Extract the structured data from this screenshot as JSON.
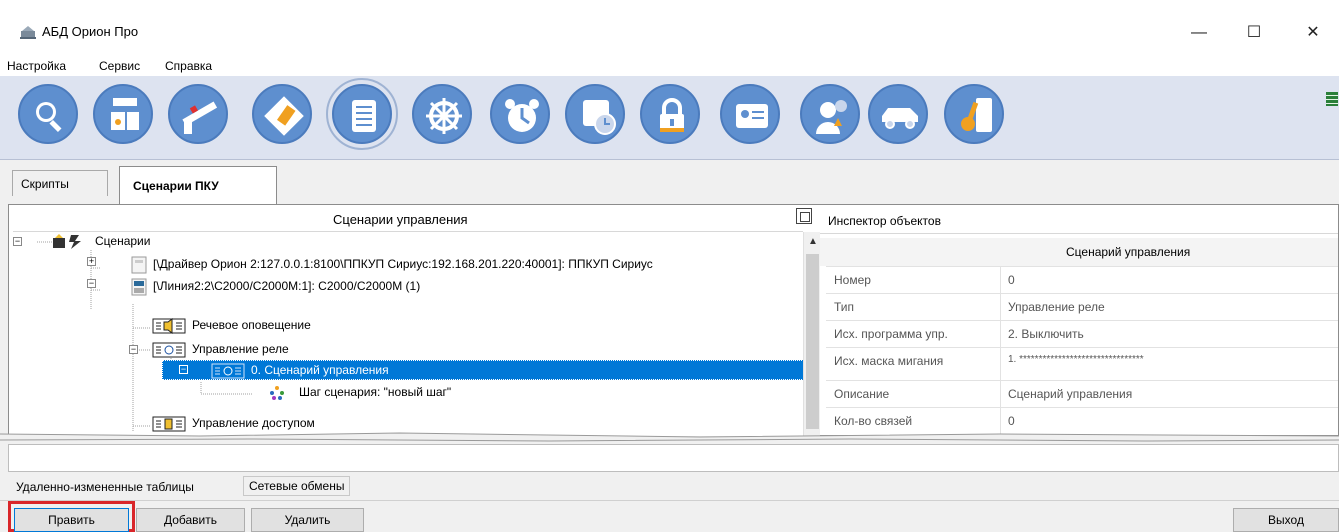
{
  "window": {
    "title": "АБД Орион Про",
    "minimize": "—",
    "maximize": "☐",
    "close": "✕"
  },
  "menu": [
    "Настройка",
    "Сервис",
    "Справка"
  ],
  "toolbar": {
    "buttons": [
      "search-icon",
      "devices-icon",
      "barrier-icon",
      "map-icon",
      "list-icon",
      "helm-icon",
      "alarm-clock-icon",
      "schedule-icon",
      "lock-icon",
      "id-card-icon",
      "person-icon",
      "car-icon",
      "key-icon"
    ],
    "accent": "#5e8fcf"
  },
  "tabs": [
    "Скрипты",
    "Сценарии ПКУ"
  ],
  "tree": {
    "header": "Сценарии управления",
    "rows": [
      "Сценарии",
      "[\\Драйвер Орион 2:127.0.0.1:8100\\ППКУП Сириус:192.168.201.220:40001]: ППКУП Сириус",
      "[\\Линия2:2\\С2000/С2000М:1]: С2000/С2000М (1)",
      "Речевое оповещение",
      "Управление реле",
      "0. Сценарий управления",
      "Шаг сценария: \"новый шаг\"",
      "Управление доступом"
    ]
  },
  "inspector": {
    "title": "Инспектор объектов",
    "subtitle": "Сценарий управления",
    "props": [
      {
        "name": "Номер",
        "value": "0"
      },
      {
        "name": "Тип",
        "value": "Управление реле"
      },
      {
        "name": "Исх. программа упр.",
        "value": "2. Выключить"
      },
      {
        "name": "Исх. маска мигания",
        "value": "1. ********************************"
      },
      {
        "name": "Описание",
        "value": "Сценарий управления"
      },
      {
        "name": "Кол-во связей",
        "value": "0"
      }
    ]
  },
  "bottom_tabs": [
    "Удаленно-измененные таблицы",
    "Сетевые обмены"
  ],
  "buttons": {
    "edit": "Править",
    "add": "Добавить",
    "delete": "Удалить",
    "exit": "Выход"
  },
  "colors": {
    "selection": "#0078d7",
    "highlight_frame": "#d9262a"
  }
}
